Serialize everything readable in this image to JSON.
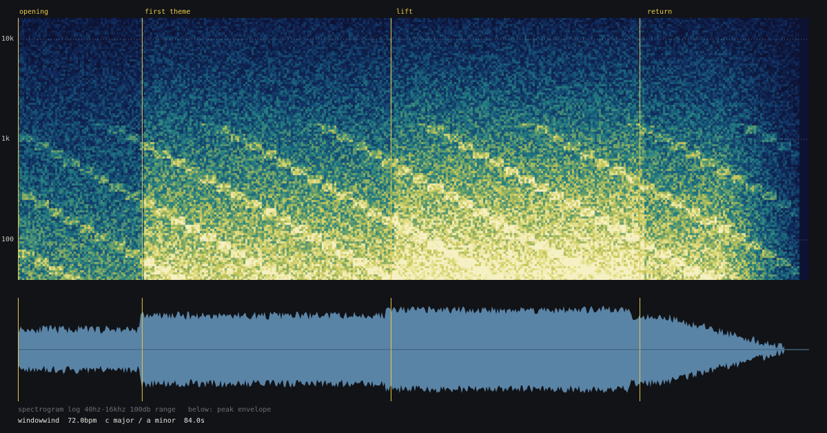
{
  "sections": [
    {
      "name": "opening",
      "time_s": 0.0
    },
    {
      "name": "first theme",
      "time_s": 13.3
    },
    {
      "name": "lift",
      "time_s": 40.0
    },
    {
      "name": "return",
      "time_s": 66.7
    }
  ],
  "frequency_axis": {
    "scale": "log",
    "min_hz": 40,
    "max_hz": 16000,
    "tick_labels": [
      "10k",
      "1k",
      "100"
    ]
  },
  "info": {
    "line1": "spectrogram log 40hz-16khz 100db range   below: peak envelope",
    "track": "windowwind",
    "bpm": "72.0bpm",
    "key": "c major / a minor",
    "duration": "84.0s"
  },
  "colors": {
    "background": "#111317",
    "section_marker": "#e7c94b",
    "waveform_fill": "#5a84a6",
    "spectrogram_low": "#0d1232",
    "spectrogram_high": "#f4efbf"
  }
}
